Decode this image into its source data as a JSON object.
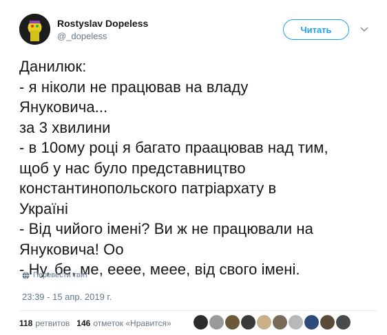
{
  "user": {
    "display_name": "Rostyslav Dopeless",
    "username": "@_dopeless",
    "avatar_icon": "user-avatar"
  },
  "follow_label": "Читать",
  "tweet_lines": [
    "Данилюк:",
    "- я ніколи не працював на владу",
    "Януковича...",
    "за 3 хвилини",
    "- в 10ому році я багато праацював над тим,",
    "щоб у нас було представництво",
    "константинопольского патріархату в",
    "Україні",
    "- Від чийого імені? Ви ж не працювали на",
    "Януковича! Оо",
    "- Ну, бе, ме, ееее, меее, від свого імені."
  ],
  "translate_label": "Перевести твит",
  "timestamp": "23:39 - 15 апр. 2019 г.",
  "stats": {
    "retweets_count": "118",
    "retweets_label": "ретвитов",
    "likes_count": "146",
    "likes_label": "отметок «Нравится»"
  },
  "likers": [
    {
      "color": "#2b2b2b"
    },
    {
      "color": "#9a9a9a"
    },
    {
      "color": "#6b5a3a"
    },
    {
      "color": "#3a3a3a"
    },
    {
      "color": "#c9b08a"
    },
    {
      "color": "#7a6a5a"
    },
    {
      "color": "#b8b8b8"
    },
    {
      "color": "#2d4a7a"
    },
    {
      "color": "#5a4a3a"
    },
    {
      "color": "#4a4a4a"
    }
  ],
  "colors": {
    "accent": "#1da1f2",
    "secondary_text": "#657786",
    "primary_text": "#14171a"
  }
}
